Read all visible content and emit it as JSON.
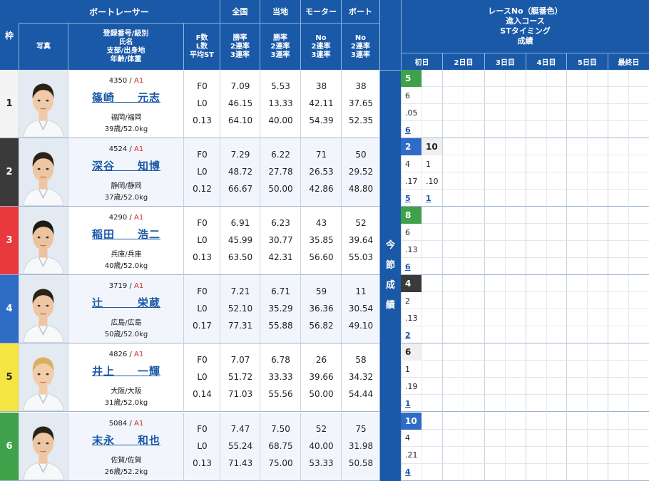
{
  "header": {
    "waku": "枠",
    "boatracer": "ボートレーサー",
    "photo": "写真",
    "profile_lines": [
      "登録番号/級別",
      "氏名",
      "支部/出身地",
      "年齢/体重"
    ],
    "fl_lines": [
      "F数",
      "L数",
      "平均ST"
    ],
    "national": "全国",
    "local": "当地",
    "motor": "モーター",
    "boat": "ボート",
    "rate_lines": [
      "勝率",
      "2連率",
      "3連率"
    ],
    "no_lines": [
      "No",
      "2連率",
      "3連率"
    ],
    "race_info_lines": [
      "レースNo（艇番色）",
      "進入コース",
      "STタイミング",
      "成績"
    ],
    "days": [
      "初日",
      "2日目",
      "3日目",
      "4日目",
      "5日目",
      "最終日"
    ],
    "konsetsu": [
      "今",
      "節",
      "成",
      "績"
    ]
  },
  "colors": {
    "header_blue": "#1a59a8",
    "waku": [
      "#f4f4f4",
      "#3a3a3a",
      "#e8393d",
      "#2f6cc6",
      "#f4e542",
      "#3fa24a"
    ]
  },
  "racers": [
    {
      "waku": "1",
      "reg": "4350",
      "cls": "A1",
      "name": "篠崎　　元志",
      "branch": "福岡/福岡",
      "age_weight": "39歳/52.0kg",
      "f": "F0",
      "l": "L0",
      "st": "0.13",
      "nat": [
        "7.09",
        "46.15",
        "64.10"
      ],
      "loc": [
        "5.53",
        "13.33",
        "40.00"
      ],
      "motor": [
        "38",
        "42.11",
        "54.39"
      ],
      "boat": [
        "38",
        "37.65",
        "52.35"
      ],
      "day1": {
        "race": "5",
        "race_color": "#3fa24a",
        "course": "6",
        "st": ".05",
        "result": "6"
      },
      "day2": null
    },
    {
      "waku": "2",
      "reg": "4524",
      "cls": "A1",
      "name": "深谷　　知博",
      "branch": "静岡/静岡",
      "age_weight": "37歳/52.0kg",
      "f": "F0",
      "l": "L0",
      "st": "0.12",
      "nat": [
        "7.29",
        "48.72",
        "66.67"
      ],
      "loc": [
        "6.22",
        "27.78",
        "50.00"
      ],
      "motor": [
        "71",
        "26.53",
        "42.86"
      ],
      "boat": [
        "50",
        "29.52",
        "48.80"
      ],
      "day1": {
        "race": "2",
        "race_color": "#2f6cc6",
        "course": "4",
        "st": ".17",
        "result": "5"
      },
      "day2": {
        "race": "10",
        "race_color": "#f0f0f0",
        "course": "1",
        "st": ".10",
        "result": "1"
      }
    },
    {
      "waku": "3",
      "reg": "4290",
      "cls": "A1",
      "name": "稲田　　浩二",
      "branch": "兵庫/兵庫",
      "age_weight": "40歳/52.0kg",
      "f": "F0",
      "l": "L0",
      "st": "0.13",
      "nat": [
        "6.91",
        "45.99",
        "63.50"
      ],
      "loc": [
        "6.23",
        "30.77",
        "42.31"
      ],
      "motor": [
        "43",
        "35.85",
        "56.60"
      ],
      "boat": [
        "52",
        "39.64",
        "55.03"
      ],
      "day1": {
        "race": "8",
        "race_color": "#3fa24a",
        "course": "6",
        "st": ".13",
        "result": "6"
      },
      "day2": null
    },
    {
      "waku": "4",
      "reg": "3719",
      "cls": "A1",
      "name": "辻　　　栄蔵",
      "branch": "広島/広島",
      "age_weight": "50歳/52.0kg",
      "f": "F0",
      "l": "L0",
      "st": "0.17",
      "nat": [
        "7.21",
        "52.10",
        "77.31"
      ],
      "loc": [
        "6.71",
        "35.29",
        "55.88"
      ],
      "motor": [
        "59",
        "36.36",
        "56.82"
      ],
      "boat": [
        "11",
        "30.54",
        "49.10"
      ],
      "day1": {
        "race": "4",
        "race_color": "#3a3a3a",
        "course": "2",
        "st": ".13",
        "result": "2"
      },
      "day2": null
    },
    {
      "waku": "5",
      "reg": "4826",
      "cls": "A1",
      "name": "井上　　一輝",
      "branch": "大阪/大阪",
      "age_weight": "31歳/52.0kg",
      "f": "F0",
      "l": "L0",
      "st": "0.14",
      "nat": [
        "7.07",
        "51.72",
        "71.03"
      ],
      "loc": [
        "6.78",
        "33.33",
        "55.56"
      ],
      "motor": [
        "26",
        "39.66",
        "50.00"
      ],
      "boat": [
        "58",
        "34.32",
        "54.44"
      ],
      "day1": {
        "race": "6",
        "race_color": "#f0f0f0",
        "course": "1",
        "st": ".19",
        "result": "1"
      },
      "day2": null
    },
    {
      "waku": "6",
      "reg": "5084",
      "cls": "A1",
      "name": "末永　　和也",
      "branch": "佐賀/佐賀",
      "age_weight": "26歳/52.2kg",
      "f": "F0",
      "l": "L0",
      "st": "0.13",
      "nat": [
        "7.47",
        "55.24",
        "71.43"
      ],
      "loc": [
        "7.50",
        "68.75",
        "75.00"
      ],
      "motor": [
        "52",
        "40.00",
        "53.33"
      ],
      "boat": [
        "75",
        "31.98",
        "50.58"
      ],
      "day1": {
        "race": "10",
        "race_color": "#2f6cc6",
        "course": "4",
        "st": ".21",
        "result": "4"
      },
      "day2": null
    }
  ]
}
